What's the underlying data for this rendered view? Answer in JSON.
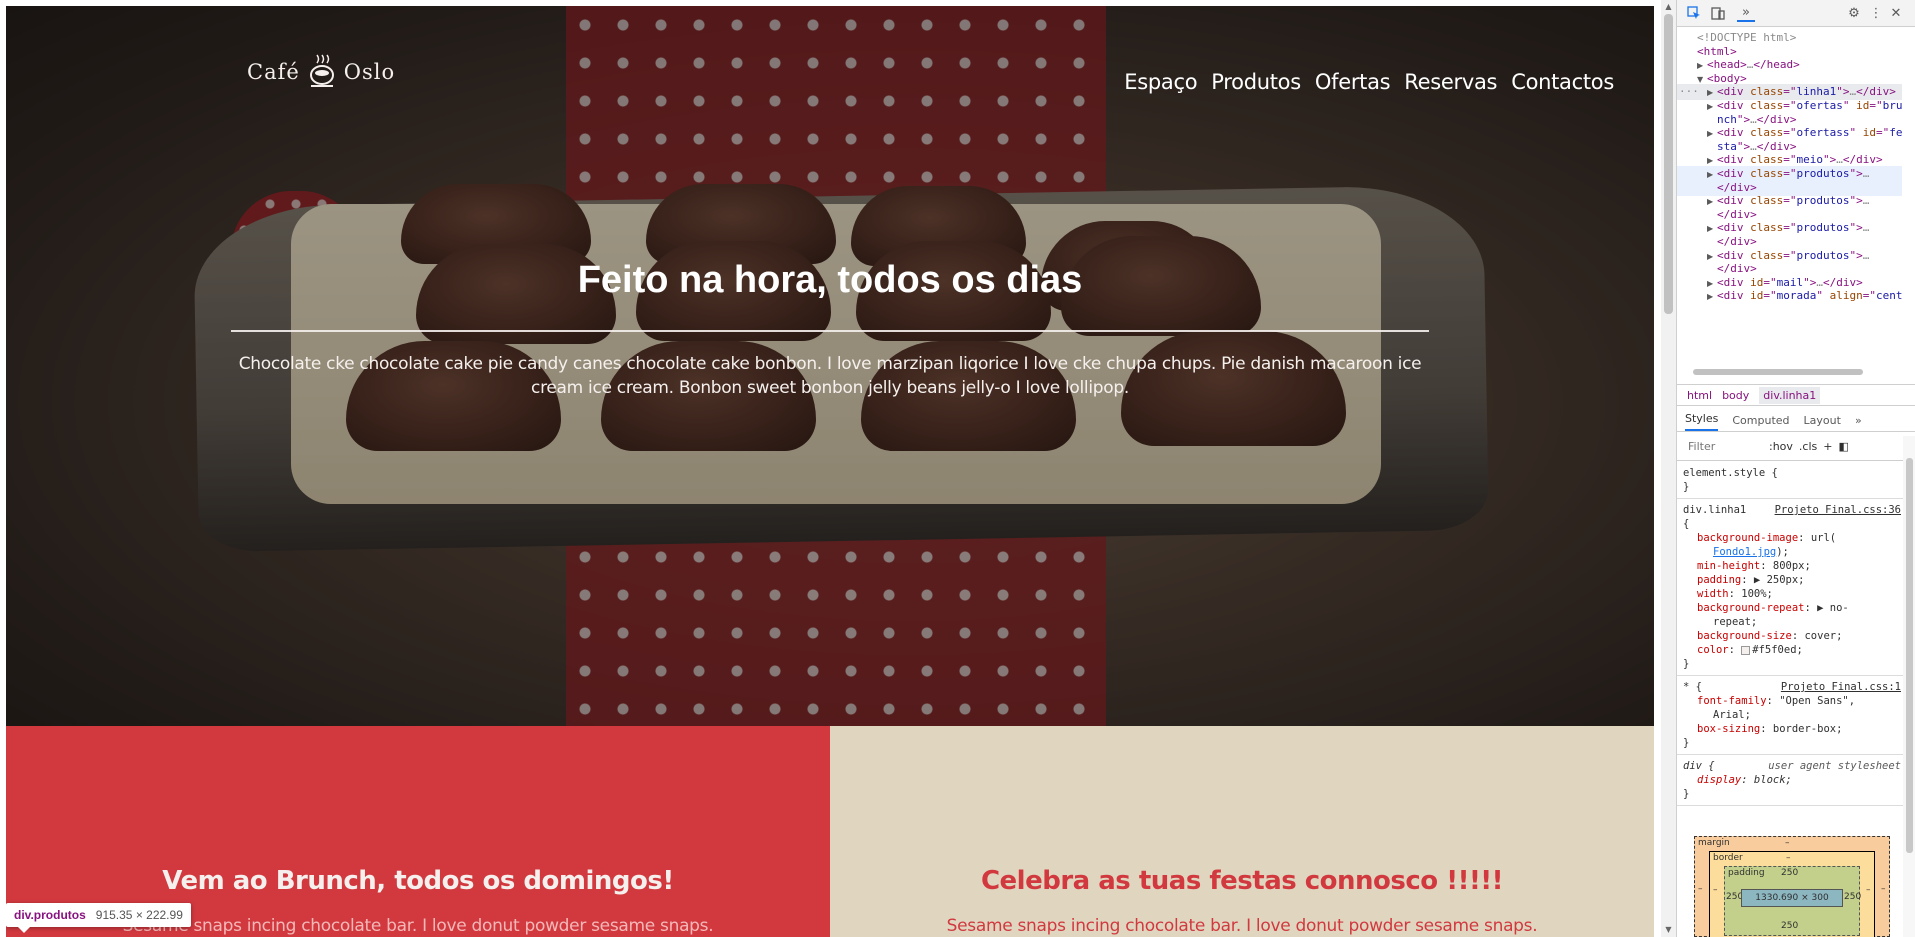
{
  "page": {
    "logo": {
      "left_word": "Café",
      "right_word": "Oslo"
    },
    "nav": [
      "Espaço",
      "Produtos",
      "Ofertas",
      "Reservas",
      "Contactos"
    ],
    "hero": {
      "title": "Feito na hora, todos os dias",
      "text": "Chocolate cke chocolate cake pie candy canes chocolate cake bonbon. I love marzipan liqorice I love cke chupa chups. Pie danish macaroon ice cream ice cream. Bonbon sweet bonbon jelly beans jelly-o I love lollipop."
    },
    "brunch": {
      "title": "Vem ao Brunch, todos os domingos!",
      "text": "Sesame snaps incing chocolate bar. I love donut powder sesame snaps."
    },
    "festas": {
      "title": "Celebra as tuas festas connosco !!!!!",
      "text": "Sesame snaps incing chocolate bar. I love donut powder sesame snaps."
    },
    "tooltip": {
      "tag": "div.produtos",
      "size": "915.35 × 222.99"
    }
  },
  "devtools": {
    "dom": [
      {
        "indent": 0,
        "tri": "",
        "parts": [
          [
            "gray",
            "<!DOCTYPE html>"
          ]
        ]
      },
      {
        "indent": 0,
        "tri": "",
        "parts": [
          [
            "tag",
            "<html>"
          ]
        ]
      },
      {
        "indent": 1,
        "tri": "▶",
        "parts": [
          [
            "tag",
            "<head>"
          ],
          [
            "gray",
            "…"
          ],
          [
            "tag",
            "</head>"
          ]
        ]
      },
      {
        "indent": 1,
        "tri": "▼",
        "parts": [
          [
            "tag",
            "<body>"
          ]
        ]
      },
      {
        "indent": 2,
        "tri": "▶",
        "parts": [
          [
            "tag",
            "<div "
          ],
          [
            "attr",
            "class"
          ],
          [
            "tag",
            "=\""
          ],
          [
            "val",
            "linha1"
          ],
          [
            "tag",
            "\">"
          ],
          [
            "gray",
            "…"
          ],
          [
            "tag",
            "</div>"
          ]
        ],
        "state": "selected"
      },
      {
        "indent": 2,
        "tri": "▶",
        "parts": [
          [
            "tag",
            "<div "
          ],
          [
            "attr",
            "class"
          ],
          [
            "tag",
            "=\""
          ],
          [
            "val",
            "ofertas"
          ],
          [
            "tag",
            "\" "
          ],
          [
            "attr",
            "id"
          ],
          [
            "tag",
            "=\""
          ],
          [
            "val",
            "bru"
          ]
        ]
      },
      {
        "indent": 2,
        "tri": "",
        "parts": [
          [
            "val",
            "nch"
          ],
          [
            "tag",
            "\">"
          ],
          [
            "gray",
            "…"
          ],
          [
            "tag",
            "</div>"
          ]
        ]
      },
      {
        "indent": 2,
        "tri": "▶",
        "parts": [
          [
            "tag",
            "<div "
          ],
          [
            "attr",
            "class"
          ],
          [
            "tag",
            "=\""
          ],
          [
            "val",
            "ofertass"
          ],
          [
            "tag",
            "\" "
          ],
          [
            "attr",
            "id"
          ],
          [
            "tag",
            "=\""
          ],
          [
            "val",
            "fe"
          ]
        ]
      },
      {
        "indent": 2,
        "tri": "",
        "parts": [
          [
            "val",
            "sta"
          ],
          [
            "tag",
            "\">"
          ],
          [
            "gray",
            "…"
          ],
          [
            "tag",
            "</div>"
          ]
        ]
      },
      {
        "indent": 2,
        "tri": "▶",
        "parts": [
          [
            "tag",
            "<div "
          ],
          [
            "attr",
            "class"
          ],
          [
            "tag",
            "=\""
          ],
          [
            "val",
            "meio"
          ],
          [
            "tag",
            "\">"
          ],
          [
            "gray",
            "…"
          ],
          [
            "tag",
            "</div>"
          ]
        ]
      },
      {
        "indent": 2,
        "tri": "▶",
        "parts": [
          [
            "tag",
            "<div "
          ],
          [
            "attr",
            "class"
          ],
          [
            "tag",
            "=\""
          ],
          [
            "val",
            "produtos"
          ],
          [
            "tag",
            "\">"
          ],
          [
            "gray",
            "…"
          ]
        ],
        "state": "hover"
      },
      {
        "indent": 2,
        "tri": "",
        "parts": [
          [
            "tag",
            "</div>"
          ]
        ],
        "state": "hover"
      },
      {
        "indent": 2,
        "tri": "▶",
        "parts": [
          [
            "tag",
            "<div "
          ],
          [
            "attr",
            "class"
          ],
          [
            "tag",
            "=\""
          ],
          [
            "val",
            "produtos"
          ],
          [
            "tag",
            "\">"
          ],
          [
            "gray",
            "…"
          ]
        ]
      },
      {
        "indent": 2,
        "tri": "",
        "parts": [
          [
            "tag",
            "</div>"
          ]
        ]
      },
      {
        "indent": 2,
        "tri": "▶",
        "parts": [
          [
            "tag",
            "<div "
          ],
          [
            "attr",
            "class"
          ],
          [
            "tag",
            "=\""
          ],
          [
            "val",
            "produtos"
          ],
          [
            "tag",
            "\">"
          ],
          [
            "gray",
            "…"
          ]
        ]
      },
      {
        "indent": 2,
        "tri": "",
        "parts": [
          [
            "tag",
            "</div>"
          ]
        ]
      },
      {
        "indent": 2,
        "tri": "▶",
        "parts": [
          [
            "tag",
            "<div "
          ],
          [
            "attr",
            "class"
          ],
          [
            "tag",
            "=\""
          ],
          [
            "val",
            "produtos"
          ],
          [
            "tag",
            "\">"
          ],
          [
            "gray",
            "…"
          ]
        ]
      },
      {
        "indent": 2,
        "tri": "",
        "parts": [
          [
            "tag",
            "</div>"
          ]
        ]
      },
      {
        "indent": 2,
        "tri": "▶",
        "parts": [
          [
            "tag",
            "<div "
          ],
          [
            "attr",
            "id"
          ],
          [
            "tag",
            "=\""
          ],
          [
            "val",
            "mail"
          ],
          [
            "tag",
            "\">"
          ],
          [
            "gray",
            "…"
          ],
          [
            "tag",
            "</div>"
          ]
        ]
      },
      {
        "indent": 2,
        "tri": "▶",
        "parts": [
          [
            "tag",
            "<div "
          ],
          [
            "attr",
            "id"
          ],
          [
            "tag",
            "=\""
          ],
          [
            "val",
            "morada"
          ],
          [
            "tag",
            "\" "
          ],
          [
            "attr",
            "align"
          ],
          [
            "tag",
            "=\""
          ],
          [
            "val",
            "cent"
          ]
        ]
      }
    ],
    "breadcrumb": [
      "html",
      "body",
      "div.linha1"
    ],
    "tabs": [
      "Styles",
      "Computed",
      "Layout",
      "»"
    ],
    "filter_placeholder": "Filter",
    "filter_buttons": [
      ":hov",
      ".cls",
      "+"
    ],
    "styles": {
      "element_style": "element.style {",
      "rule1": {
        "selector": "div.linha1",
        "source": "Projeto Final.css:36",
        "bg_prop": "background-image",
        "bg_val": "url(",
        "bg_file": "Fondo1.jpg",
        "bg_close": ");",
        "min_height": "800px;",
        "padding": "▶ 250px;",
        "width": "100%;",
        "bg_repeat": "▶ no-",
        "bg_repeat_cont": "repeat;",
        "bg_size": "cover;",
        "color": "#f5f0ed;"
      },
      "rule2": {
        "selector": "* {",
        "source": "Projeto Final.css:1",
        "font_family": "\"Open Sans\",",
        "font_family_cont": "Arial;",
        "box_sizing": "border-box;"
      },
      "rule3": {
        "selector": "div {",
        "source": "user agent stylesheet",
        "display": "block;"
      }
    },
    "boxmodel": {
      "margin_label": "margin",
      "margin_val": "–",
      "border_label": "border",
      "border_val": "–",
      "padding_label": "padding",
      "padding_val": "250",
      "side": "250",
      "content": "1330.690 × 300",
      "dash": "–"
    }
  }
}
